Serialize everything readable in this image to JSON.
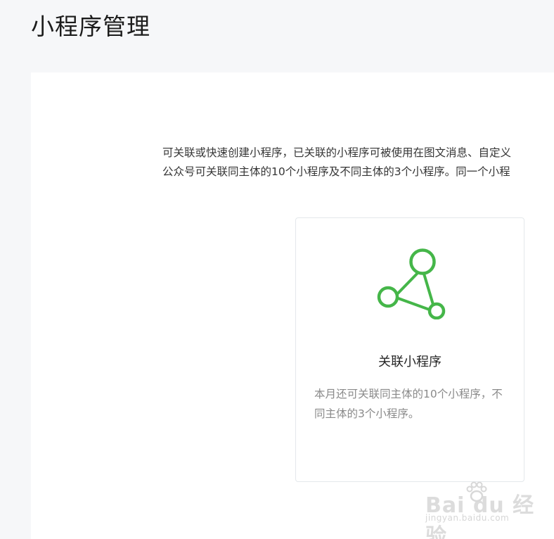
{
  "page": {
    "title": "小程序管理"
  },
  "intro": {
    "line1": "可关联或快速创建小程序，已关联的小程序可被使用在图文消息、自定义",
    "line2": "公众号可关联同主体的10个小程序及不同主体的3个小程序。同一个小程"
  },
  "card": {
    "title": "关联小程序",
    "description": "本月还可关联同主体的10个小程序，不同主体的3个小程序。",
    "icon": "mini-program-link-icon",
    "icon_color": "#45b649"
  },
  "watermark": {
    "logo": "Bai du 经验",
    "url": "jingyan.baidu.com"
  }
}
